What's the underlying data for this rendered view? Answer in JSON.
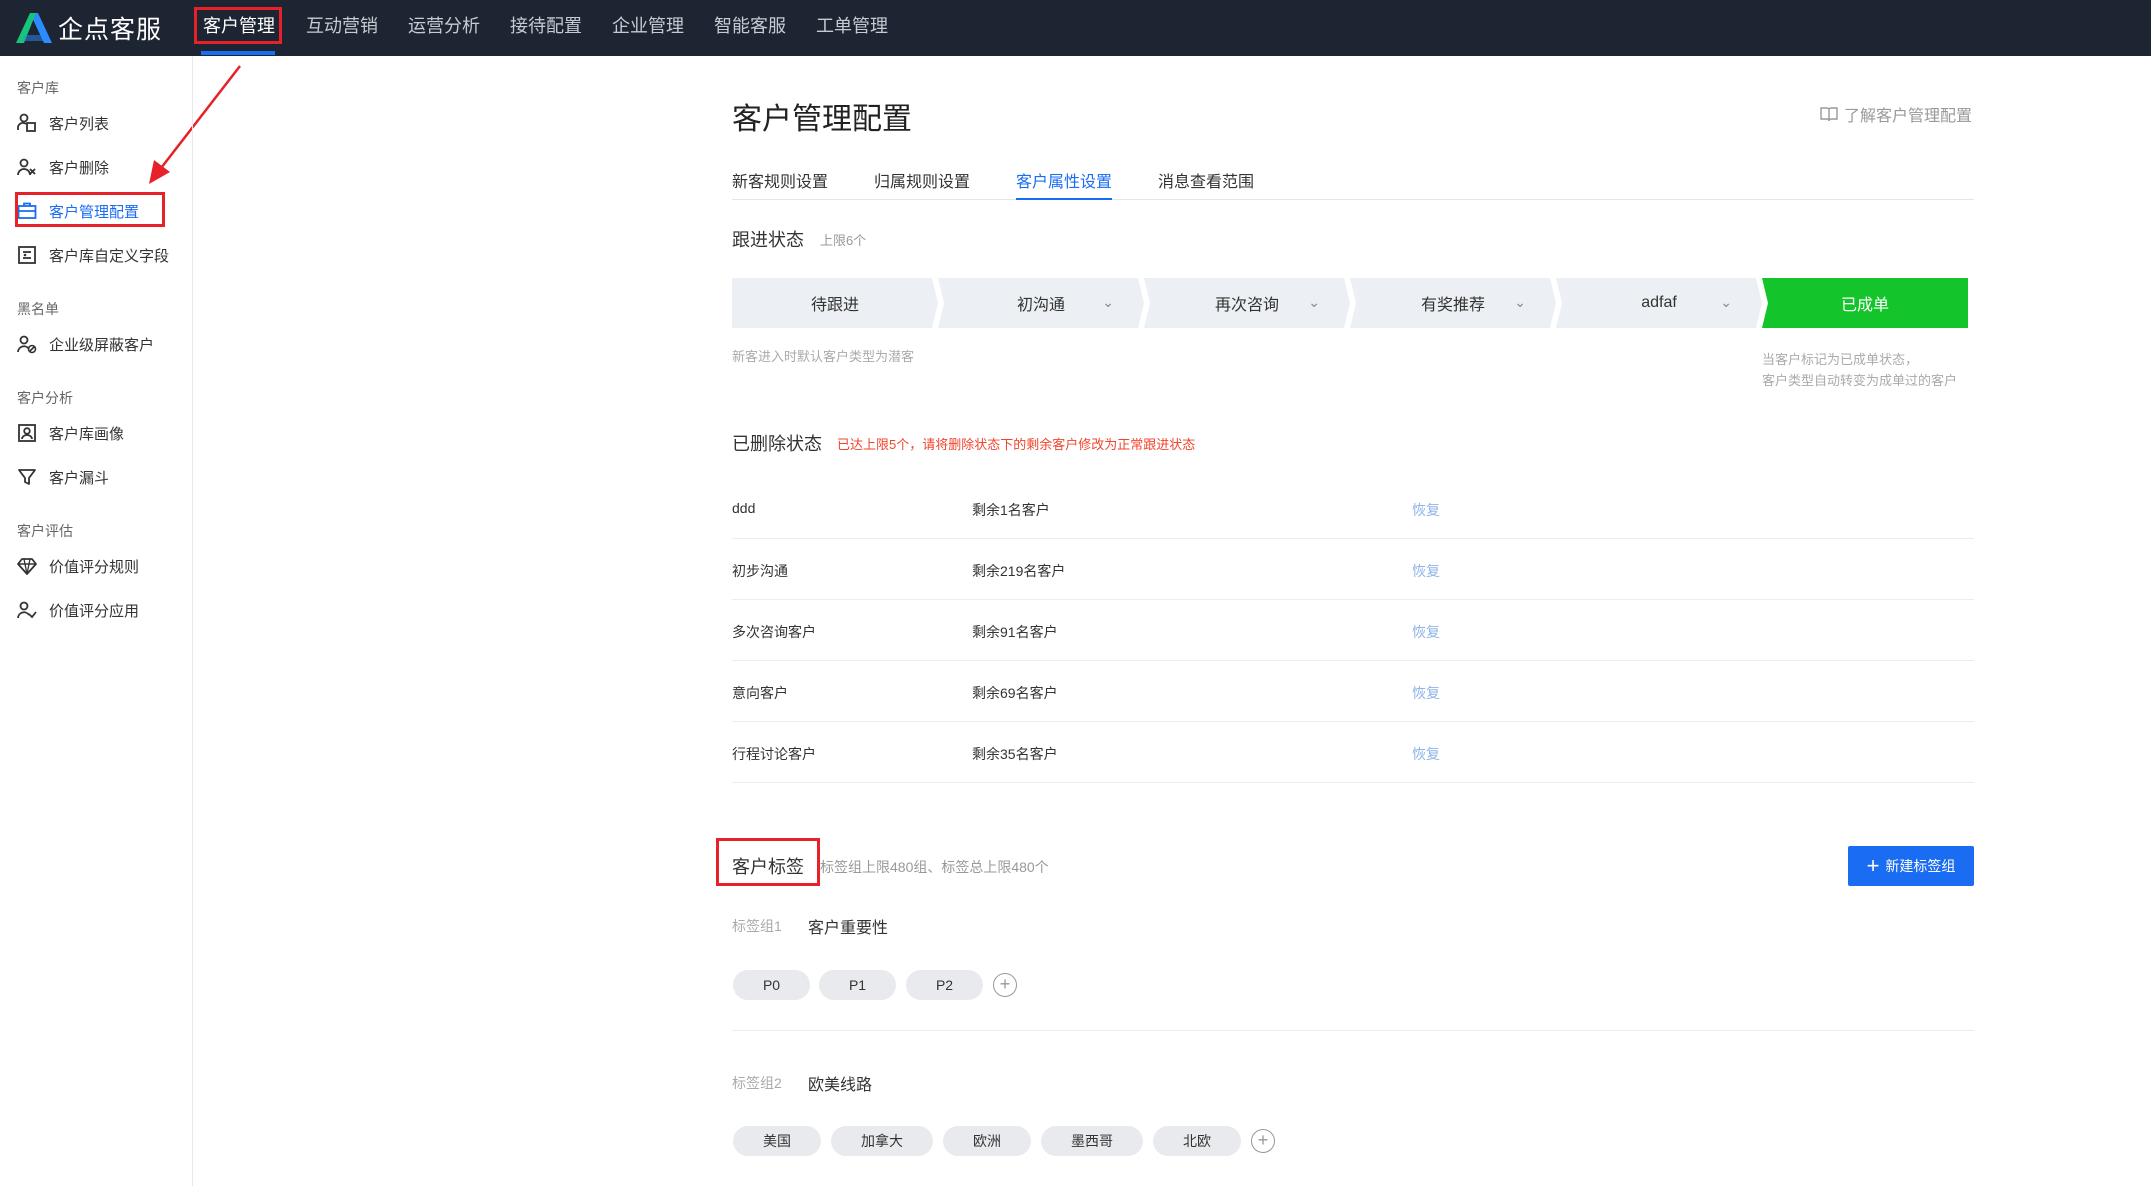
{
  "app": {
    "name": "企点客服"
  },
  "topnav": {
    "items": [
      "客户管理",
      "互动营销",
      "运营分析",
      "接待配置",
      "企业管理",
      "智能客服",
      "工单管理"
    ]
  },
  "sidebar": {
    "groups": [
      {
        "label": "客户库",
        "items": [
          {
            "label": "客户列表",
            "icon": "customer-list-icon"
          },
          {
            "label": "客户删除",
            "icon": "user-remove-icon"
          },
          {
            "label": "客户管理配置",
            "icon": "briefcase-icon"
          },
          {
            "label": "客户库自定义字段",
            "icon": "custom-field-icon"
          }
        ]
      },
      {
        "label": "黑名单",
        "items": [
          {
            "label": "企业级屏蔽客户",
            "icon": "user-block-icon"
          }
        ]
      },
      {
        "label": "客户分析",
        "items": [
          {
            "label": "客户库画像",
            "icon": "portrait-icon"
          },
          {
            "label": "客户漏斗",
            "icon": "funnel-icon"
          }
        ]
      },
      {
        "label": "客户评估",
        "items": [
          {
            "label": "价值评分规则",
            "icon": "diamond-icon"
          },
          {
            "label": "价值评分应用",
            "icon": "user-score-icon"
          }
        ]
      }
    ]
  },
  "main": {
    "title": "客户管理配置",
    "learn_link": "了解客户管理配置",
    "tabs": [
      "新客规则设置",
      "归属规则设置",
      "客户属性设置",
      "消息查看范围"
    ],
    "follow": {
      "title": "跟进状态",
      "note": "上限6个",
      "steps": [
        "待跟进",
        "初沟通",
        "再次咨询",
        "有奖推荐",
        "adfaf",
        "已成单"
      ],
      "hint_left": "新客进入时默认客户类型为潜客",
      "hint_right_1": "当客户标记为已成单状态，",
      "hint_right_2": "客户类型自动转变为成单过的客户"
    },
    "deleted": {
      "title": "已删除状态",
      "warning": "已达上限5个，请将删除状态下的剩余客户修改为正常跟进状态",
      "restore_label": "恢复",
      "rows": [
        {
          "name": "ddd",
          "remain": "剩余1名客户"
        },
        {
          "name": "初步沟通",
          "remain": "剩余219名客户"
        },
        {
          "name": "多次咨询客户",
          "remain": "剩余91名客户"
        },
        {
          "name": "意向客户",
          "remain": "剩余69名客户"
        },
        {
          "name": "行程讨论客户",
          "remain": "剩余35名客户"
        }
      ]
    },
    "tags": {
      "title": "客户标签",
      "note": "标签组上限480组、标签总上限480个",
      "new_button": "新建标签组",
      "groups": [
        {
          "label": "标签组1",
          "name": "客户重要性",
          "tags": [
            "P0",
            "P1",
            "P2"
          ]
        },
        {
          "label": "标签组2",
          "name": "欧美线路",
          "tags": [
            "美国",
            "加拿大",
            "欧洲",
            "墨西哥",
            "北欧"
          ]
        }
      ]
    }
  },
  "colors": {
    "primary": "#1a6cf3",
    "success": "#13c52b",
    "warning": "#f0452d",
    "nav_bg": "#1e2532",
    "highlight": "#e6212a"
  }
}
